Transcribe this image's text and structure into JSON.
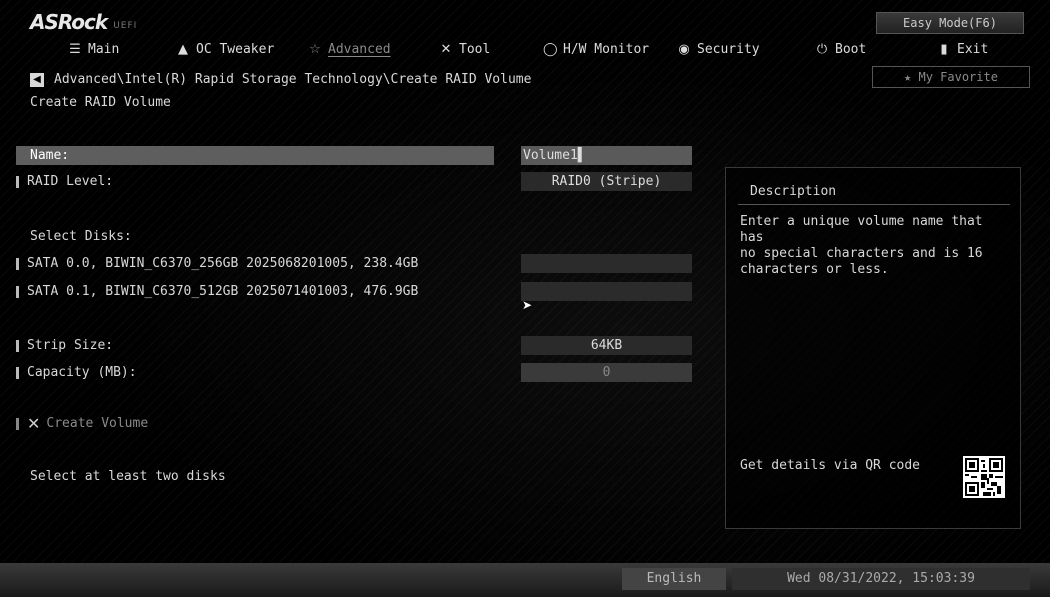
{
  "header": {
    "logo": "ASRock",
    "logo_sub": "UEFI",
    "easy_mode": "Easy Mode(F6)",
    "my_favorite": "My Favorite"
  },
  "tabs": [
    {
      "label": "Main",
      "icon": "list-icon"
    },
    {
      "label": "OC Tweaker",
      "icon": "rocket-icon"
    },
    {
      "label": "Advanced",
      "icon": "star-icon",
      "active": true
    },
    {
      "label": "Tool",
      "icon": "tools-icon"
    },
    {
      "label": "H/W Monitor",
      "icon": "monitor-icon"
    },
    {
      "label": "Security",
      "icon": "shield-icon"
    },
    {
      "label": "Boot",
      "icon": "power-icon"
    },
    {
      "label": "Exit",
      "icon": "exit-icon"
    }
  ],
  "breadcrumb": "Advanced\\Intel(R) Rapid Storage Technology\\Create RAID Volume",
  "page_title": "Create RAID Volume",
  "form": {
    "name_label": "Name:",
    "name_value": "Volume1",
    "raid_level_label": "RAID Level:",
    "raid_level_value": "RAID0 (Stripe)",
    "select_disks_label": "Select Disks:",
    "disks": [
      {
        "label": "SATA 0.0, BIWIN_C6370_256GB 2025068201005, 238.4GB",
        "value": ""
      },
      {
        "label": "SATA 0.1, BIWIN_C6370_512GB 2025071401003, 476.9GB",
        "value": ""
      }
    ],
    "strip_size_label": "Strip Size:",
    "strip_size_value": "64KB",
    "capacity_label": "Capacity (MB):",
    "capacity_value": "0",
    "create_volume_label": "Create Volume",
    "hint": "Select at least two disks"
  },
  "description": {
    "title": "Description",
    "text": "Enter a unique volume name that has\nno special characters and is 16\ncharacters or less.",
    "qr_label": "Get details via QR code"
  },
  "footer": {
    "language": "English",
    "datetime": "Wed 08/31/2022, 15:03:39"
  }
}
